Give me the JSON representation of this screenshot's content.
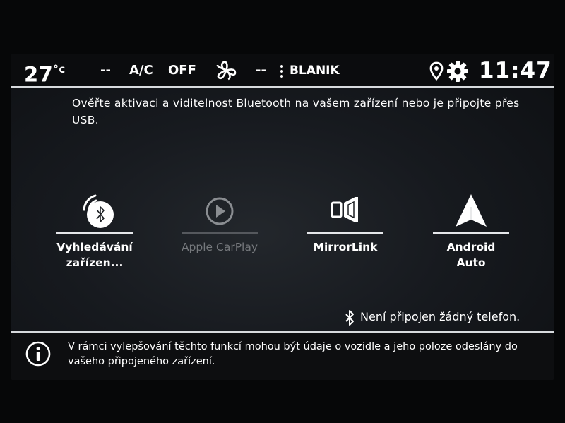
{
  "status_bar": {
    "temperature": "27",
    "temperature_unit": "°c",
    "fan_left": "--",
    "ac_label": "A/C",
    "ac_state": "OFF",
    "fan_right": "--",
    "blanik_label": "BLANIK",
    "clock": "11:47"
  },
  "main": {
    "instruction": "Ověřte aktivaci a viditelnost Bluetooth na vašem zařízení nebo je připojte přes USB.",
    "tiles": [
      {
        "label": "Vyhledávání zařízen...",
        "icon": "bluetooth-search-icon",
        "enabled": true
      },
      {
        "label": "Apple CarPlay",
        "icon": "carplay-play-icon",
        "enabled": false
      },
      {
        "label": "MirrorLink",
        "icon": "mirrorlink-icon",
        "enabled": true
      },
      {
        "label": "Android Auto",
        "icon": "android-auto-icon",
        "enabled": true
      }
    ],
    "phone_status": "Není připojen žádný telefon."
  },
  "info_bar": {
    "text": "V rámci vylepšování těchto funkcí mohou být údaje o vozidle a jeho poloze odeslány do vašeho připojeného zařízení."
  },
  "colors": {
    "text": "#ffffff",
    "disabled": "#76797d",
    "divider": "#d7dadd",
    "background": "#171a1f"
  }
}
